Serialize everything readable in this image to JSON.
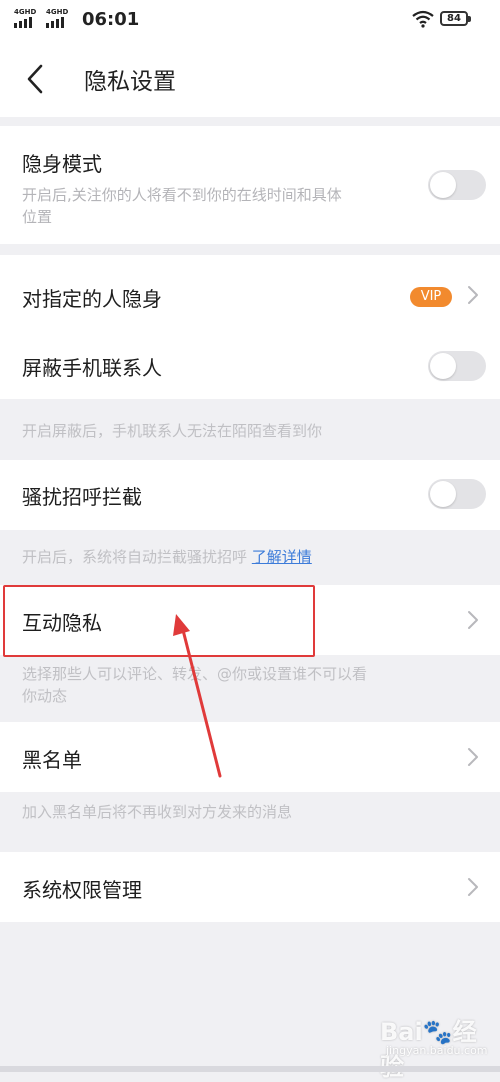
{
  "status_bar": {
    "network_1": "4GHD",
    "network_2": "4GHD",
    "time": "06:01",
    "battery": "84"
  },
  "header": {
    "title": "隐私设置",
    "back_icon": "chevron-left-icon"
  },
  "settings": {
    "stealth_mode": {
      "label": "隐身模式",
      "description_line1": "开启后,关注你的人将看不到你的在线时间和具体",
      "description_line2": "位置",
      "enabled": false
    },
    "hide_from_specific": {
      "label": "对指定的人隐身",
      "badge": "VIP"
    },
    "block_contacts": {
      "label": "屏蔽手机联系人",
      "enabled": false,
      "hint": "开启屏蔽后，手机联系人无法在陌陌查看到你"
    },
    "harassment_block": {
      "label": "骚扰招呼拦截",
      "enabled": false,
      "hint": "开启后，系统将自动拦截骚扰招呼",
      "hint_link": "了解详情"
    },
    "interaction_privacy": {
      "label": "互动隐私",
      "hint_line1": "选择那些人可以评论、转发、@你或设置谁不可以看",
      "hint_line2": "你动态"
    },
    "blacklist": {
      "label": "黑名单",
      "hint": "加入黑名单后将不再收到对方发来的消息"
    },
    "system_permissions": {
      "label": "系统权限管理"
    }
  },
  "annotation": {
    "highlight_color": "#e03a3a"
  },
  "watermark": {
    "logo": "Bai🐾经验",
    "sub": "jingyan.baidu.com"
  },
  "colors": {
    "background": "#f0f0f3",
    "row": "#ffffff",
    "vip": "#f28a2e",
    "link": "#3c7bd9",
    "toggle_off": "#e3e3e6"
  }
}
